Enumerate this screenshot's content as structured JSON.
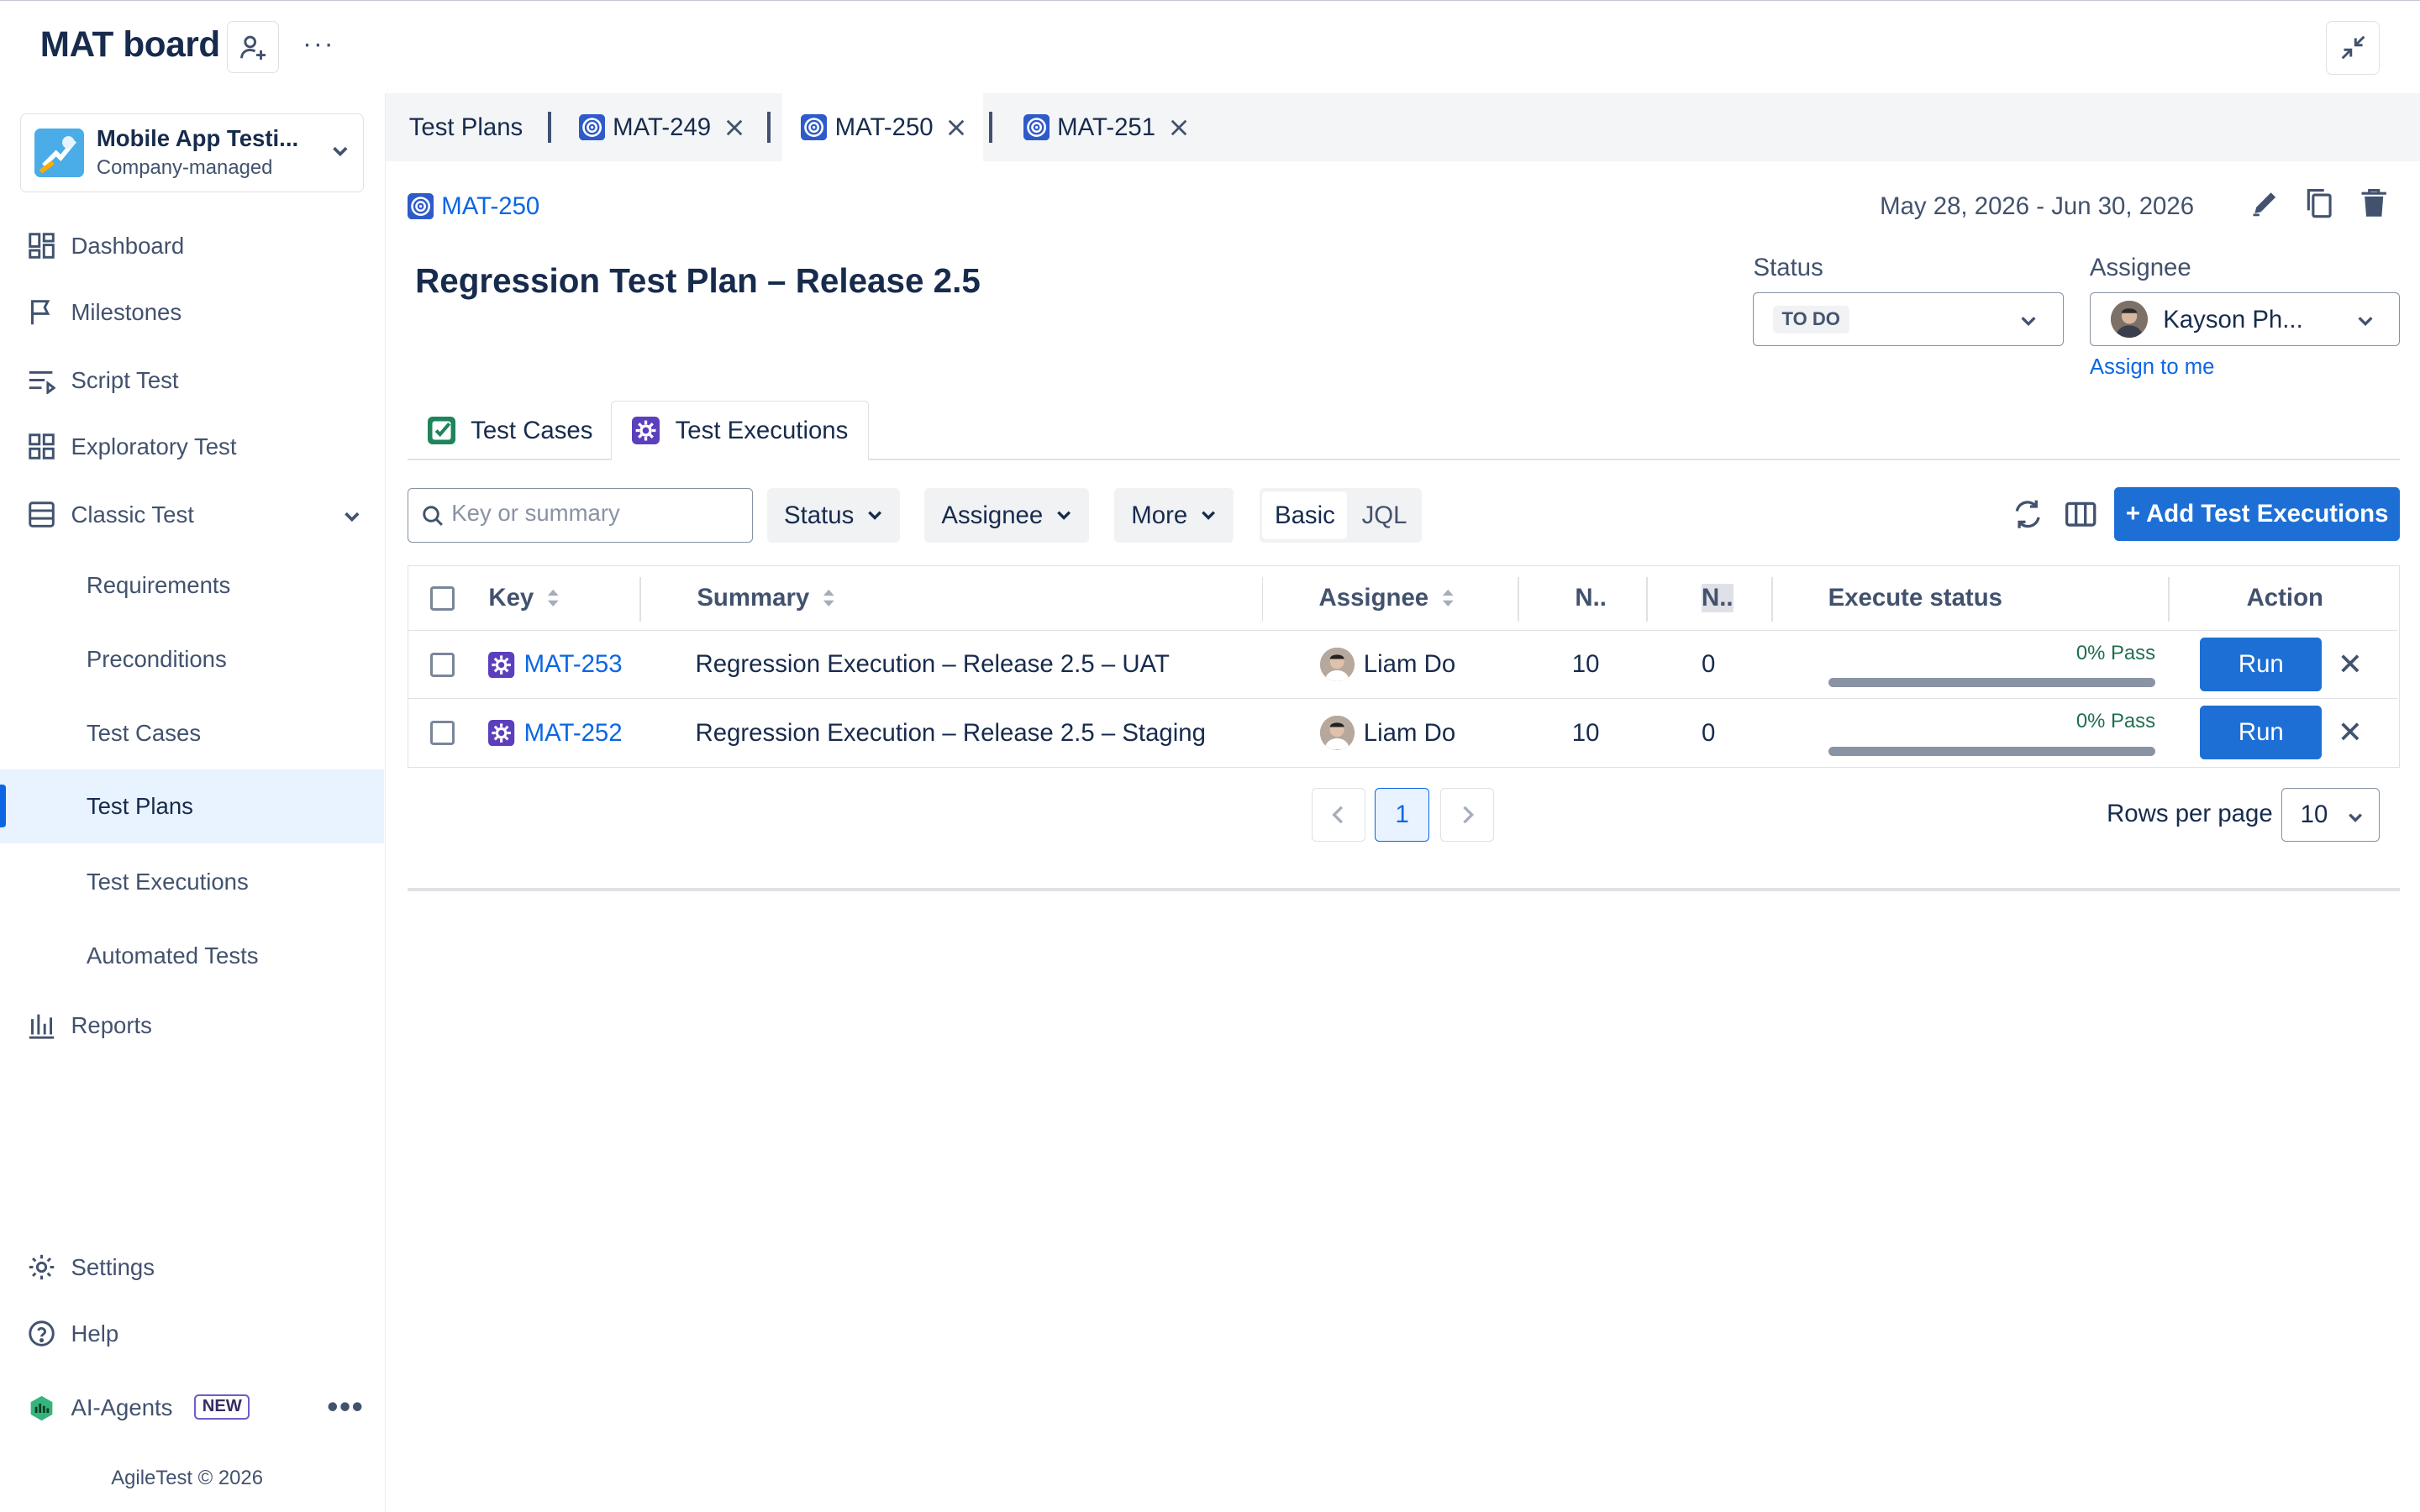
{
  "header": {
    "board_title": "MAT board"
  },
  "sidebar": {
    "project": {
      "name": "Mobile App Testi...",
      "type": "Company-managed"
    },
    "items": [
      {
        "label": "Dashboard",
        "icon": "dashboard-icon"
      },
      {
        "label": "Milestones",
        "icon": "flag-icon"
      },
      {
        "label": "Script Test",
        "icon": "script-icon"
      },
      {
        "label": "Exploratory Test",
        "icon": "grid-icon"
      },
      {
        "label": "Classic Test",
        "icon": "table-icon",
        "expanded": true
      }
    ],
    "sub_items": [
      {
        "label": "Requirements"
      },
      {
        "label": "Preconditions"
      },
      {
        "label": "Test Cases"
      },
      {
        "label": "Test Plans",
        "active": true
      },
      {
        "label": "Test Executions"
      },
      {
        "label": "Automated Tests"
      }
    ],
    "reports": "Reports",
    "settings": "Settings",
    "help": "Help",
    "ai_agents": "AI-Agents",
    "new_badge": "NEW",
    "footer": "AgileTest © 2026"
  },
  "tabs": [
    {
      "label": "Test Plans"
    },
    {
      "label": "MAT-249"
    },
    {
      "label": "MAT-250",
      "active": true
    },
    {
      "label": "MAT-251"
    }
  ],
  "plan": {
    "key": "MAT-250",
    "title": "Regression Test Plan – Release 2.5",
    "date_range": "May 28, 2026 - Jun 30, 2026",
    "status_label": "Status",
    "status_value": "TO DO",
    "assignee_label": "Assignee",
    "assignee_value": "Kayson Ph...",
    "assign_to_me": "Assign to me"
  },
  "content_tabs": [
    {
      "label": "Test Cases"
    },
    {
      "label": "Test Executions",
      "active": true
    }
  ],
  "toolbar": {
    "search_placeholder": "Key or summary",
    "filters": [
      "Status",
      "Assignee",
      "More"
    ],
    "mode_basic": "Basic",
    "mode_jql": "JQL",
    "add_button": "+ Add Test Executions"
  },
  "table": {
    "columns": [
      "Key",
      "Summary",
      "Assignee",
      "N..",
      "N..",
      "Execute status",
      "Action"
    ],
    "rows": [
      {
        "key": "MAT-253",
        "summary": "Regression Execution – Release 2.5 – UAT",
        "assignee": "Liam Do",
        "n1": "10",
        "n2": "0",
        "pass_text": "0% Pass",
        "pass_fraction": 0,
        "action": "Run"
      },
      {
        "key": "MAT-252",
        "summary": "Regression Execution – Release 2.5 – Staging",
        "assignee": "Liam Do",
        "n1": "10",
        "n2": "0",
        "pass_text": "0% Pass",
        "pass_fraction": 0,
        "action": "Run"
      }
    ]
  },
  "pagination": {
    "current_page": "1",
    "rows_per_page_label": "Rows per page",
    "rows_per_page": "10"
  },
  "colors": {
    "primary": "#1d6fd6",
    "link": "#0c66e4",
    "active_nav_bg": "#e9f2ff"
  }
}
